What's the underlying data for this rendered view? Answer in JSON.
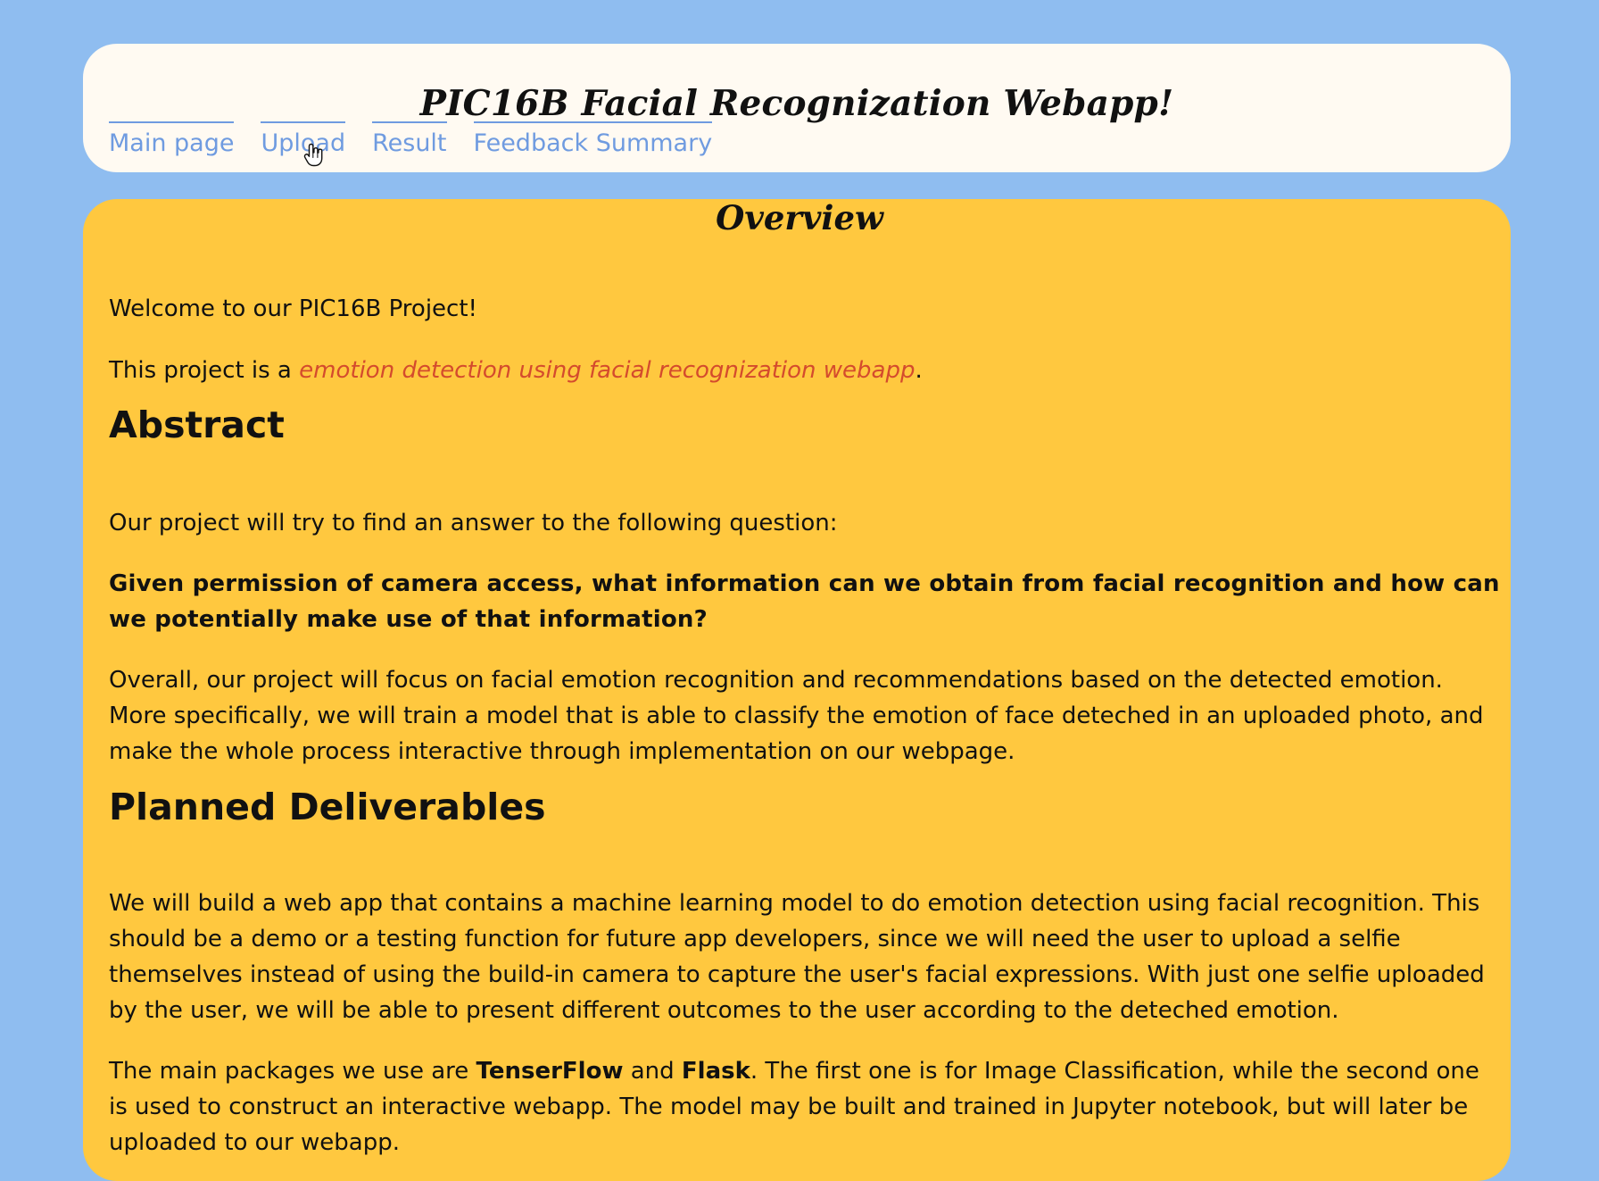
{
  "header": {
    "title": "PIC16B Facial Recognization Webapp!",
    "nav": [
      "Main page",
      "Upload",
      "Result",
      "Feedback Summary"
    ]
  },
  "content": {
    "overview_title": "Overview",
    "welcome": "Welcome to our PIC16B Project!",
    "project_intro_prefix": "This project is a ",
    "project_intro_highlight": "emotion detection using facial recognization webapp",
    "project_intro_suffix": ".",
    "abstract_heading": "Abstract",
    "abstract_intro": "Our project will try to find an answer to the following question:",
    "abstract_question": "Given permission of camera access, what information can we obtain from facial recognition and how can we potentially make use of that information?",
    "abstract_overall": "Overall, our project will focus on facial emotion recognition and recommendations based on the detected emotion. More specifically, we will train a model that is able to classify the emotion of face deteched in an uploaded photo, and make the whole process interactive through implementation on our webpage.",
    "deliverables_heading": "Planned Deliverables",
    "deliverables_paragraph_1": "We will build a web app that contains a machine learning model to do emotion detection using facial recognition. This should be a demo or a testing function for future app developers, since we will need the user to upload a selfie themselves instead of using the build-in camera to capture the user's facial expressions. With just one selfie uploaded by the user, we will be able to present different outcomes to the user according to the deteched emotion.",
    "deliverables_paragraph_2_prefix": "The main packages we use are ",
    "deliverables_paragraph_2_tensor": "TenserFlow",
    "deliverables_paragraph_2_and": " and ",
    "deliverables_paragraph_2_flask": "Flask",
    "deliverables_paragraph_2_suffix": ". The first one is for Image Classification, while the second one is used to construct an interactive webapp. The model may be built and trained in Jupyter notebook, but will later be uploaded to our webapp."
  },
  "colors": {
    "background": "#8fbdf0",
    "header_card": "#fffaf2",
    "content_card": "#ffc83f",
    "nav_link": "#6f9be0",
    "highlight": "#d44b2d",
    "text": "#111111"
  },
  "icons": {
    "cursor": "hand-pointer-cursor-icon"
  }
}
